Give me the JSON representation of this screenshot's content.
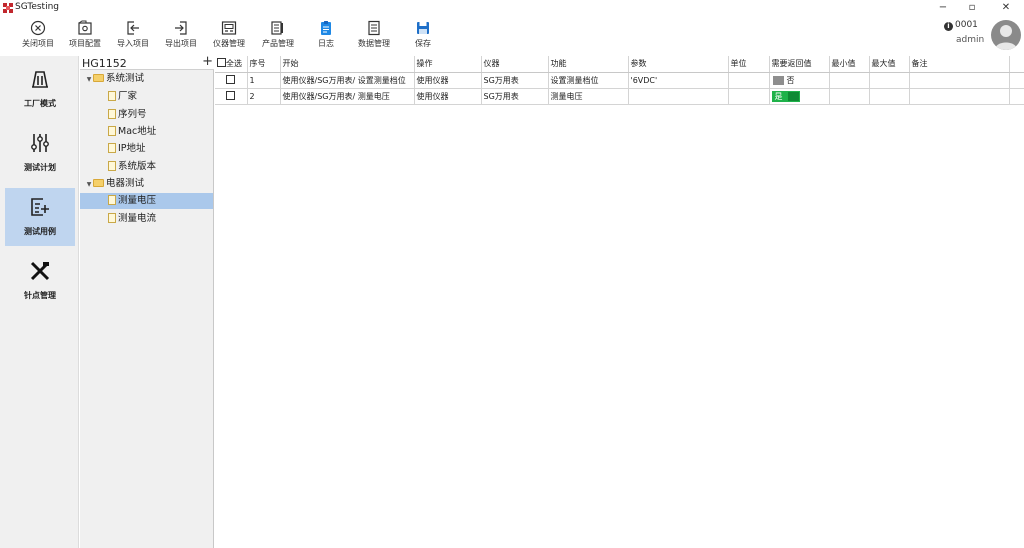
{
  "app": {
    "title": "SGTesting",
    "brand_color": "#c0272d"
  },
  "toolbar": {
    "items": [
      {
        "label": "关闭项目",
        "icon": "close-circle-icon"
      },
      {
        "label": "项目配置",
        "icon": "project-config-icon"
      },
      {
        "label": "导入项目",
        "icon": "import-icon"
      },
      {
        "label": "导出项目",
        "icon": "export-icon"
      },
      {
        "label": "仪器管理",
        "icon": "instrument-icon"
      },
      {
        "label": "产品管理",
        "icon": "product-icon"
      },
      {
        "label": "日志",
        "icon": "log-icon"
      },
      {
        "label": "数据管理",
        "icon": "data-icon"
      },
      {
        "label": "保存",
        "icon": "save-icon"
      }
    ]
  },
  "user": {
    "id": "0001",
    "name": "admin"
  },
  "leftnav": {
    "items": [
      {
        "label": "工厂模式",
        "icon": "factory-icon"
      },
      {
        "label": "测试计划",
        "icon": "sliders-icon"
      },
      {
        "label": "测试用例",
        "icon": "test-case-icon",
        "active": true
      },
      {
        "label": "针点管理",
        "icon": "tools-icon"
      }
    ]
  },
  "tree": {
    "title": "HG1152",
    "add_symbol": "+",
    "groups": [
      {
        "label": "系统测试",
        "children": [
          "厂家",
          "序列号",
          "Mac地址",
          "IP地址",
          "系统版本"
        ]
      },
      {
        "label": "电器测试",
        "children": [
          "测量电压",
          "测量电流"
        ]
      }
    ],
    "selected": "测量电压"
  },
  "grid": {
    "select_all": "全选",
    "columns": [
      "序号",
      "开始",
      "操作",
      "仪器",
      "功能",
      "参数",
      "单位",
      "需要返回值",
      "最小值",
      "最大值",
      "备注"
    ],
    "rows": [
      {
        "seq": "1",
        "start": "使用仪器/SG万用表/ 设置测量档位",
        "op": "使用仪器",
        "instrument": "SG万用表",
        "function": "设置测量档位",
        "param": "'6VDC'",
        "unit": "",
        "need_return": "否",
        "min": "",
        "max": "",
        "note": ""
      },
      {
        "seq": "2",
        "start": "使用仪器/SG万用表/ 测量电压",
        "op": "使用仪器",
        "instrument": "SG万用表",
        "function": "测量电压",
        "param": "",
        "unit": "",
        "need_return": "是",
        "min": "",
        "max": "",
        "note": ""
      }
    ],
    "toggle_on_color": "#1fb24a",
    "toggle_off_color": "#8e8e8e"
  },
  "window": {
    "minimize": "−",
    "restore": "▫",
    "close": "✕"
  }
}
